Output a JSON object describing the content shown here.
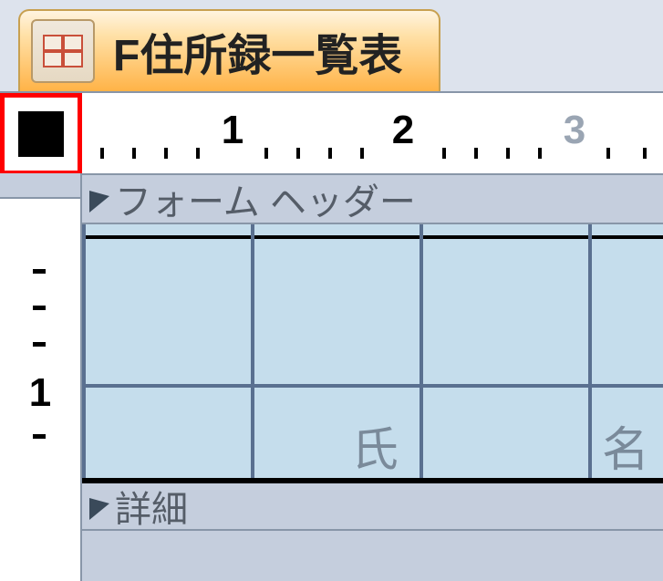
{
  "tab": {
    "title": "F住所録一覧表"
  },
  "ruler": {
    "marks": [
      "1",
      "2",
      "3"
    ]
  },
  "vruler": {
    "mark": "1"
  },
  "sections": {
    "form_header": "フォーム ヘッダー",
    "detail": "詳細"
  },
  "header_cells": {
    "c1": "氏",
    "c2": "名"
  }
}
